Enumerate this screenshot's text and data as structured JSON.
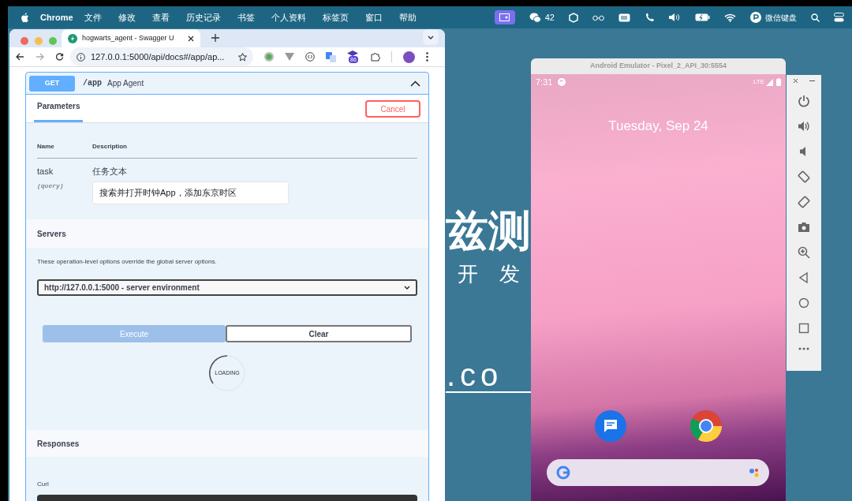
{
  "menubar": {
    "app": "Chrome",
    "menus": [
      "文件",
      "修改",
      "查看",
      "历史记录",
      "书签",
      "个人资料",
      "标签页",
      "窗口",
      "帮助"
    ],
    "wechat_count": "42",
    "input_method": "微信键盘"
  },
  "browser": {
    "tab_title": "hogwarts_agent - Swagger U",
    "url": "127.0.0.1:5000/api/docs#/app/ap...",
    "extension_badge": "86"
  },
  "operation": {
    "method": "GET",
    "path": "/app",
    "summary": "App Agent"
  },
  "parameters": {
    "tab": "Parameters",
    "cancel": "Cancel",
    "columns": [
      "Name",
      "Description"
    ],
    "params": [
      {
        "name": "task",
        "location": "(query)",
        "description": "任务文本",
        "value": "搜索并打开时钟App，添加东京时区"
      }
    ]
  },
  "servers": {
    "title": "Servers",
    "note": "These operation-level options override the global server options.",
    "selected": "http://127.0.0.1:5000 - server environment"
  },
  "actions": [
    {
      "label": "Execute",
      "disabled": true
    },
    {
      "label": "Clear",
      "disabled": false
    }
  ],
  "loading": "LOADING",
  "responses": {
    "title": "Responses",
    "curl_label": "Curl"
  },
  "wallpaper": {
    "texts": [
      "兹测",
      "开 发",
      ".co"
    ]
  },
  "emulator": {
    "title": "Android Emulator - Pixel_2_API_30:5554",
    "time": "7:31",
    "network": "LTE",
    "date": "Tuesday, Sep 24"
  }
}
